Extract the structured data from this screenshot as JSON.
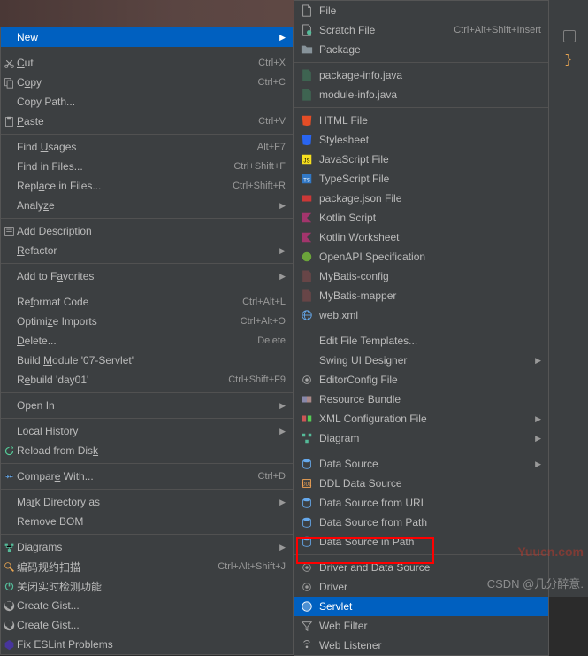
{
  "main_menu": {
    "new": "New",
    "cut": "Cut",
    "cut_sc": "Ctrl+X",
    "copy": "Copy",
    "copy_sc": "Ctrl+C",
    "copy_path": "Copy Path...",
    "paste": "Paste",
    "paste_sc": "Ctrl+V",
    "find_usages": "Find Usages",
    "find_usages_sc": "Alt+F7",
    "find_in_files": "Find in Files...",
    "find_in_files_sc": "Ctrl+Shift+F",
    "replace_in_files": "Replace in Files...",
    "replace_in_files_sc": "Ctrl+Shift+R",
    "analyze": "Analyze",
    "add_description": "Add Description",
    "refactor": "Refactor",
    "add_to_favorites": "Add to Favorites",
    "reformat_code": "Reformat Code",
    "reformat_code_sc": "Ctrl+Alt+L",
    "optimize_imports": "Optimize Imports",
    "optimize_imports_sc": "Ctrl+Alt+O",
    "delete": "Delete...",
    "delete_sc": "Delete",
    "build_module": "Build Module '07-Servlet'",
    "rebuild": "Rebuild 'day01'",
    "rebuild_sc": "Ctrl+Shift+F9",
    "open_in": "Open In",
    "local_history": "Local History",
    "reload_from_disk": "Reload from Disk",
    "compare_with": "Compare With...",
    "compare_with_sc": "Ctrl+D",
    "mark_directory_as": "Mark Directory as",
    "remove_bom": "Remove BOM",
    "diagrams": "Diagrams",
    "scan_code": "编码规约扫描",
    "scan_code_sc": "Ctrl+Alt+Shift+J",
    "close_realtime": "关闭实时检测功能",
    "create_gist1": "Create Gist...",
    "create_gist2": "Create Gist...",
    "fix_eslint": "Fix ESLint Problems"
  },
  "sub_menu": {
    "file": "File",
    "scratch_file": "Scratch File",
    "scratch_file_sc": "Ctrl+Alt+Shift+Insert",
    "package": "Package",
    "package_info": "package-info.java",
    "module_info": "module-info.java",
    "html_file": "HTML File",
    "stylesheet": "Stylesheet",
    "js_file": "JavaScript File",
    "ts_file": "TypeScript File",
    "package_json": "package.json File",
    "kotlin_script": "Kotlin Script",
    "kotlin_worksheet": "Kotlin Worksheet",
    "openapi_spec": "OpenAPI Specification",
    "mybatis_config": "MyBatis-config",
    "mybatis_mapper": "MyBatis-mapper",
    "web_xml": "web.xml",
    "edit_file_templates": "Edit File Templates...",
    "swing_ui_designer": "Swing UI Designer",
    "editorconfig_file": "EditorConfig File",
    "resource_bundle": "Resource Bundle",
    "xml_config_file": "XML Configuration File",
    "diagram": "Diagram",
    "data_source": "Data Source",
    "ddl_data_source": "DDL Data Source",
    "data_source_url": "Data Source from URL",
    "data_source_path": "Data Source from Path",
    "data_source_in_path": "Data Source in Path",
    "driver_data_source": "Driver and Data Source",
    "driver": "Driver",
    "servlet": "Servlet",
    "web_filter": "Web Filter",
    "web_listener": "Web Listener"
  },
  "watermark1": "Yuucn.com",
  "watermark2": "CSDN @几分醉意."
}
